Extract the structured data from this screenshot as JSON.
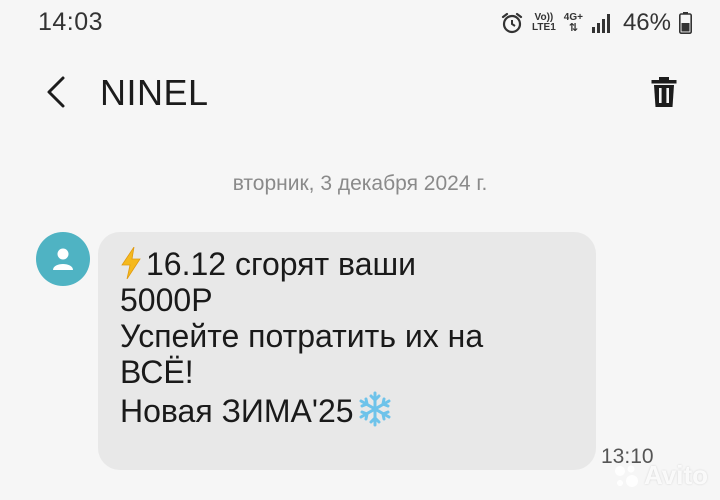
{
  "status_bar": {
    "time": "14:03",
    "volte_top": "Vo))",
    "volte_bottom": "LTE1",
    "network_type": "4G+",
    "battery_percent": "46%",
    "icons": [
      "alarm-icon",
      "signal-icon",
      "battery-icon"
    ]
  },
  "header": {
    "contact_name": "NINEL",
    "icons": [
      "back-arrow-icon",
      "trash-icon"
    ]
  },
  "conversation": {
    "date_divider": "вторник, 3 декабря 2024 г.",
    "messages": [
      {
        "lines": [
          "16.12 сгорят ваши",
          "5000Р",
          "Успейте потратить их на",
          "ВСЁ!",
          "Новая ЗИМА'25"
        ],
        "time": "13:10",
        "icons": [
          "lightning-emoji-icon",
          "snowflake-emoji-icon"
        ]
      }
    ]
  },
  "watermark": {
    "text": "Avito"
  },
  "colors": {
    "background": "#f6f6f6",
    "bubble": "#e8e8e8",
    "avatar": "#4fb3c3",
    "lightning": "#f5b91e",
    "snowflake": "#6ec3ea"
  }
}
